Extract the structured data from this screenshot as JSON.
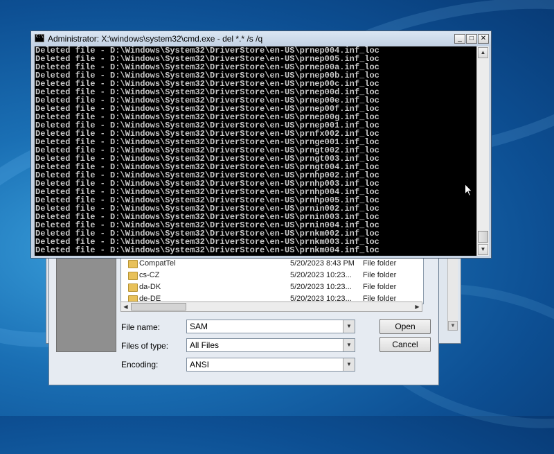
{
  "cmd": {
    "title": "Administrator: X:\\windows\\system32\\cmd.exe - del  *.* /s /q",
    "lines": [
      "Deleted file - D:\\Windows\\System32\\DriverStore\\en-US\\prnep004.inf_loc",
      "Deleted file - D:\\Windows\\System32\\DriverStore\\en-US\\prnep005.inf_loc",
      "Deleted file - D:\\Windows\\System32\\DriverStore\\en-US\\prnep00a.inf_loc",
      "Deleted file - D:\\Windows\\System32\\DriverStore\\en-US\\prnep00b.inf_loc",
      "Deleted file - D:\\Windows\\System32\\DriverStore\\en-US\\prnep00c.inf_loc",
      "Deleted file - D:\\Windows\\System32\\DriverStore\\en-US\\prnep00d.inf_loc",
      "Deleted file - D:\\Windows\\System32\\DriverStore\\en-US\\prnep00e.inf_loc",
      "Deleted file - D:\\Windows\\System32\\DriverStore\\en-US\\prnep00f.inf_loc",
      "Deleted file - D:\\Windows\\System32\\DriverStore\\en-US\\prnep00g.inf_loc",
      "Deleted file - D:\\Windows\\System32\\DriverStore\\en-US\\prnep001.inf_loc",
      "Deleted file - D:\\Windows\\System32\\DriverStore\\en-US\\prnfx002.inf_loc",
      "Deleted file - D:\\Windows\\System32\\DriverStore\\en-US\\prnge001.inf_loc",
      "Deleted file - D:\\Windows\\System32\\DriverStore\\en-US\\prngt002.inf_loc",
      "Deleted file - D:\\Windows\\System32\\DriverStore\\en-US\\prngt003.inf_loc",
      "Deleted file - D:\\Windows\\System32\\DriverStore\\en-US\\prngt004.inf_loc",
      "Deleted file - D:\\Windows\\System32\\DriverStore\\en-US\\prnhp002.inf_loc",
      "Deleted file - D:\\Windows\\System32\\DriverStore\\en-US\\prnhp003.inf_loc",
      "Deleted file - D:\\Windows\\System32\\DriverStore\\en-US\\prnhp004.inf_loc",
      "Deleted file - D:\\Windows\\System32\\DriverStore\\en-US\\prnhp005.inf_loc",
      "Deleted file - D:\\Windows\\System32\\DriverStore\\en-US\\prnin002.inf_loc",
      "Deleted file - D:\\Windows\\System32\\DriverStore\\en-US\\prnin003.inf_loc",
      "Deleted file - D:\\Windows\\System32\\DriverStore\\en-US\\prnin004.inf_loc",
      "Deleted file - D:\\Windows\\System32\\DriverStore\\en-US\\prnkm002.inf_loc",
      "Deleted file - D:\\Windows\\System32\\DriverStore\\en-US\\prnkm003.inf_loc",
      "Deleted file - D:\\Windows\\System32\\DriverStore\\en-US\\prnkm004.inf_loc"
    ],
    "buttons": {
      "minimize": "_",
      "maximize": "□",
      "close": "✕"
    }
  },
  "dialog": {
    "files": [
      {
        "name": "CompatTel",
        "date": "5/20/2023 8:43 PM",
        "type": "File folder"
      },
      {
        "name": "cs-CZ",
        "date": "5/20/2023 10:23...",
        "type": "File folder"
      },
      {
        "name": "da-DK",
        "date": "5/20/2023 10:23...",
        "type": "File folder"
      },
      {
        "name": "de-DE",
        "date": "5/20/2023 10:23...",
        "type": "File folder"
      }
    ],
    "file_name_label": "File name:",
    "file_name_value": "SAM",
    "files_of_type_label": "Files of type:",
    "files_of_type_value": "All Files",
    "encoding_label": "Encoding:",
    "encoding_value": "ANSI",
    "open_label": "Open",
    "cancel_label": "Cancel"
  }
}
